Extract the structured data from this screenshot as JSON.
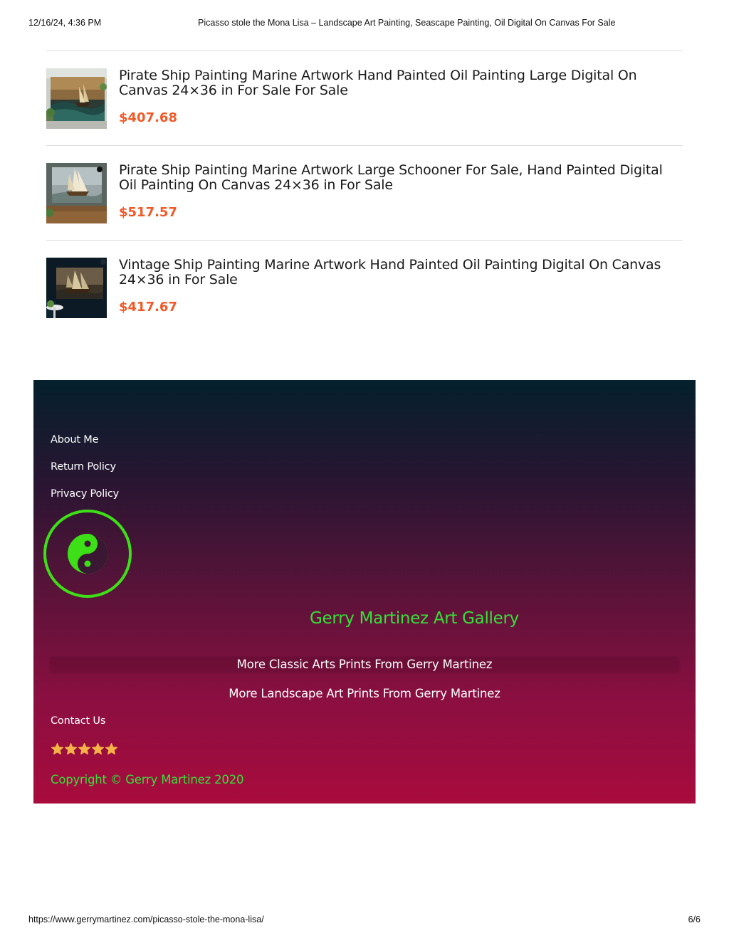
{
  "print_header": {
    "date": "12/16/24, 4:36 PM",
    "title": "Picasso stole the Mona Lisa – Landscape Art Painting, Seascape Painting, Oil Digital On Canvas For Sale"
  },
  "products": [
    {
      "title": "Pirate Ship Painting Marine Artwork Hand Painted Oil Painting Large Digital On Canvas 24×36 in For Sale For Sale",
      "price": "$407.68"
    },
    {
      "title": "Pirate Ship Painting Marine Artwork Large Schooner For Sale, Hand Painted Digital Oil Painting On Canvas 24×36 in For Sale",
      "price": "$517.57"
    },
    {
      "title": "Vintage Ship Painting Marine Artwork Hand Painted Oil Painting Digital On Canvas 24×36 in For Sale",
      "price": "$417.67"
    }
  ],
  "footer": {
    "links": [
      "About Me",
      "Return Policy",
      "Privacy Policy"
    ],
    "logo_icon": "yin-yang-icon",
    "gallery_title": "Gerry Martinez Art Gallery",
    "more_classic": "More Classic Arts Prints From Gerry Martinez",
    "more_landscape": "More Landscape Art Prints From Gerry Martinez",
    "contact": "Contact Us",
    "rating_stars": 5,
    "copyright": "Copyright © Gerry Martinez 2020"
  },
  "colors": {
    "price": "#f05a28",
    "accent_green": "#35e03a",
    "star": "#f5b347",
    "footer_top": "#04202c",
    "footer_bottom": "#a90b3d"
  },
  "print_footer": {
    "url": "https://www.gerrymartinez.com/picasso-stole-the-mona-lisa/",
    "page": "6/6"
  }
}
